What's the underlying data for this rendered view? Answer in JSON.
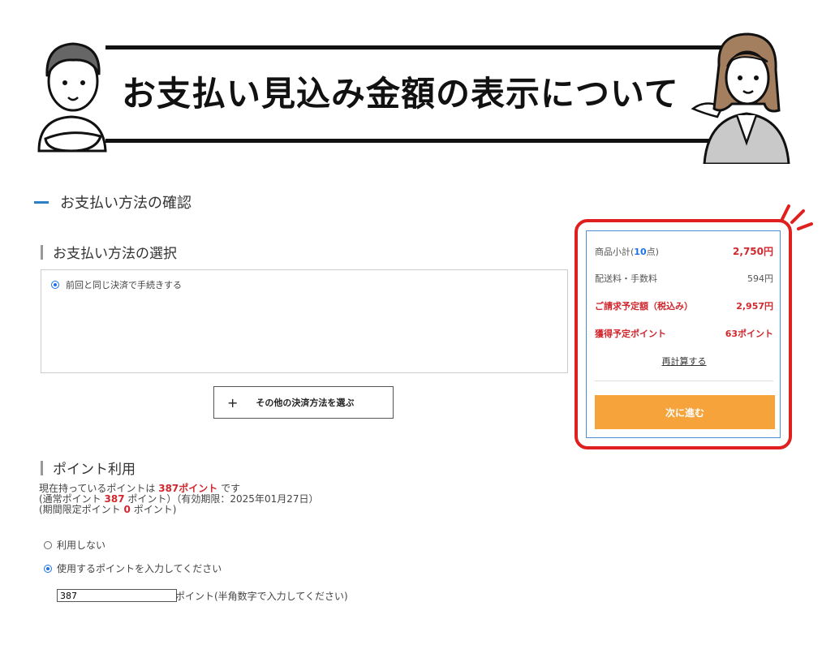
{
  "banner": {
    "title": "お支払い見込み金額の表示について"
  },
  "section": {
    "title": "お支払い方法の確認"
  },
  "payment": {
    "heading": "お支払い方法の選択",
    "option_label": "前回と同じ決済で手続きする",
    "other_button": "その他の決済方法を選ぶ"
  },
  "summary": {
    "subtotal_label_prefix": "商品小計(",
    "subtotal_count": "10",
    "subtotal_label_suffix": "点)",
    "subtotal_value": "2,750円",
    "shipping_label": "配送料・手数料",
    "shipping_value": "594円",
    "total_label": "ご請求予定額（税込み）",
    "total_value": "2,957円",
    "points_label": "獲得予定ポイント",
    "points_value": "63ポイント",
    "recalc_link": "再計算する",
    "next_button": "次に進む"
  },
  "points": {
    "heading": "ポイント利用",
    "line1_prefix": "現在持っているポイントは",
    "line1_value": "387ポイント",
    "line1_suffix": "です",
    "line2_prefix": "(通常ポイント",
    "line2_value": "387",
    "line2_suffix": "ポイント）（有効期限：2025年01月27日）",
    "line3_prefix": "(期間限定ポイント",
    "line3_value": "0",
    "line3_suffix": "ポイント)",
    "option_none": "利用しない",
    "option_use": "使用するポイントを入力してください",
    "input_value": "387",
    "input_suffix": "ポイント(半角数字で入力してください)"
  },
  "colors": {
    "accent_red": "#d0282e",
    "ring_red": "#e0201e",
    "next_orange": "#f5a33a",
    "link_blue": "#1a73e8"
  }
}
